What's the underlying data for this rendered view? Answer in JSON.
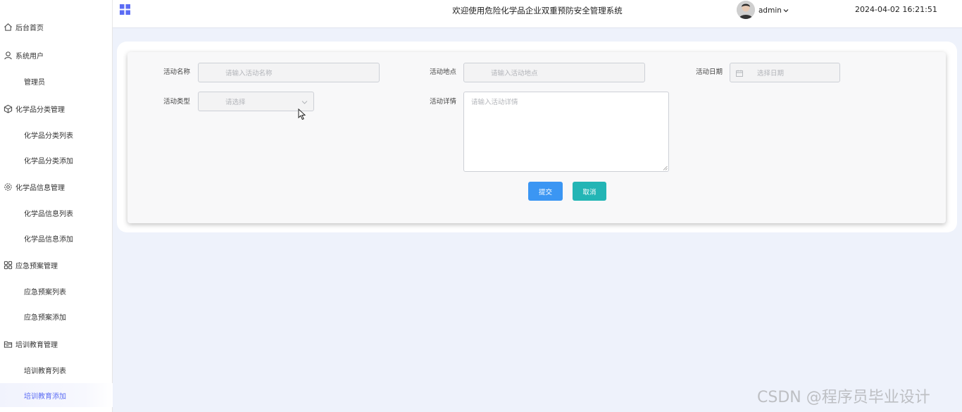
{
  "header": {
    "title": "欢迎使用危险化学品企业双重预防安全管理系统",
    "username": "admin",
    "datetime": "2024-04-02 16:21:51",
    "menu_icon": "grid-icon",
    "accent_color": "#5b6cf4"
  },
  "sidebar": {
    "items": [
      {
        "label": "后台首页",
        "type": "group",
        "icon": "home-icon"
      },
      {
        "label": "系统用户",
        "type": "group",
        "icon": "user-icon"
      },
      {
        "label": "管理员",
        "type": "sub"
      },
      {
        "label": "化学品分类管理",
        "type": "group",
        "icon": "cube-icon"
      },
      {
        "label": "化学品分类列表",
        "type": "sub"
      },
      {
        "label": "化学品分类添加",
        "type": "sub"
      },
      {
        "label": "化学品信息管理",
        "type": "group",
        "icon": "gear-icon"
      },
      {
        "label": "化学品信息列表",
        "type": "sub"
      },
      {
        "label": "化学品信息添加",
        "type": "sub"
      },
      {
        "label": "应急预案管理",
        "type": "group",
        "icon": "apps-icon"
      },
      {
        "label": "应急预案列表",
        "type": "sub"
      },
      {
        "label": "应急预案添加",
        "type": "sub"
      },
      {
        "label": "培训教育管理",
        "type": "group",
        "icon": "folder-icon"
      },
      {
        "label": "培训教育列表",
        "type": "sub"
      },
      {
        "label": "培训教育添加",
        "type": "sub",
        "active": true
      }
    ]
  },
  "form": {
    "name_label": "活动名称",
    "name_placeholder": "请输入活动名称",
    "location_label": "活动地点",
    "location_placeholder": "请输入活动地点",
    "date_label": "活动日期",
    "date_placeholder": "选择日期",
    "type_label": "活动类型",
    "type_placeholder": "请选择",
    "detail_label": "活动详情",
    "detail_placeholder": "请输入活动详情",
    "submit_label": "提交",
    "cancel_label": "取消",
    "submit_color": "#3b96f3",
    "cancel_color": "#23b5b5"
  },
  "watermark": "CSDN @程序员毕业设计"
}
